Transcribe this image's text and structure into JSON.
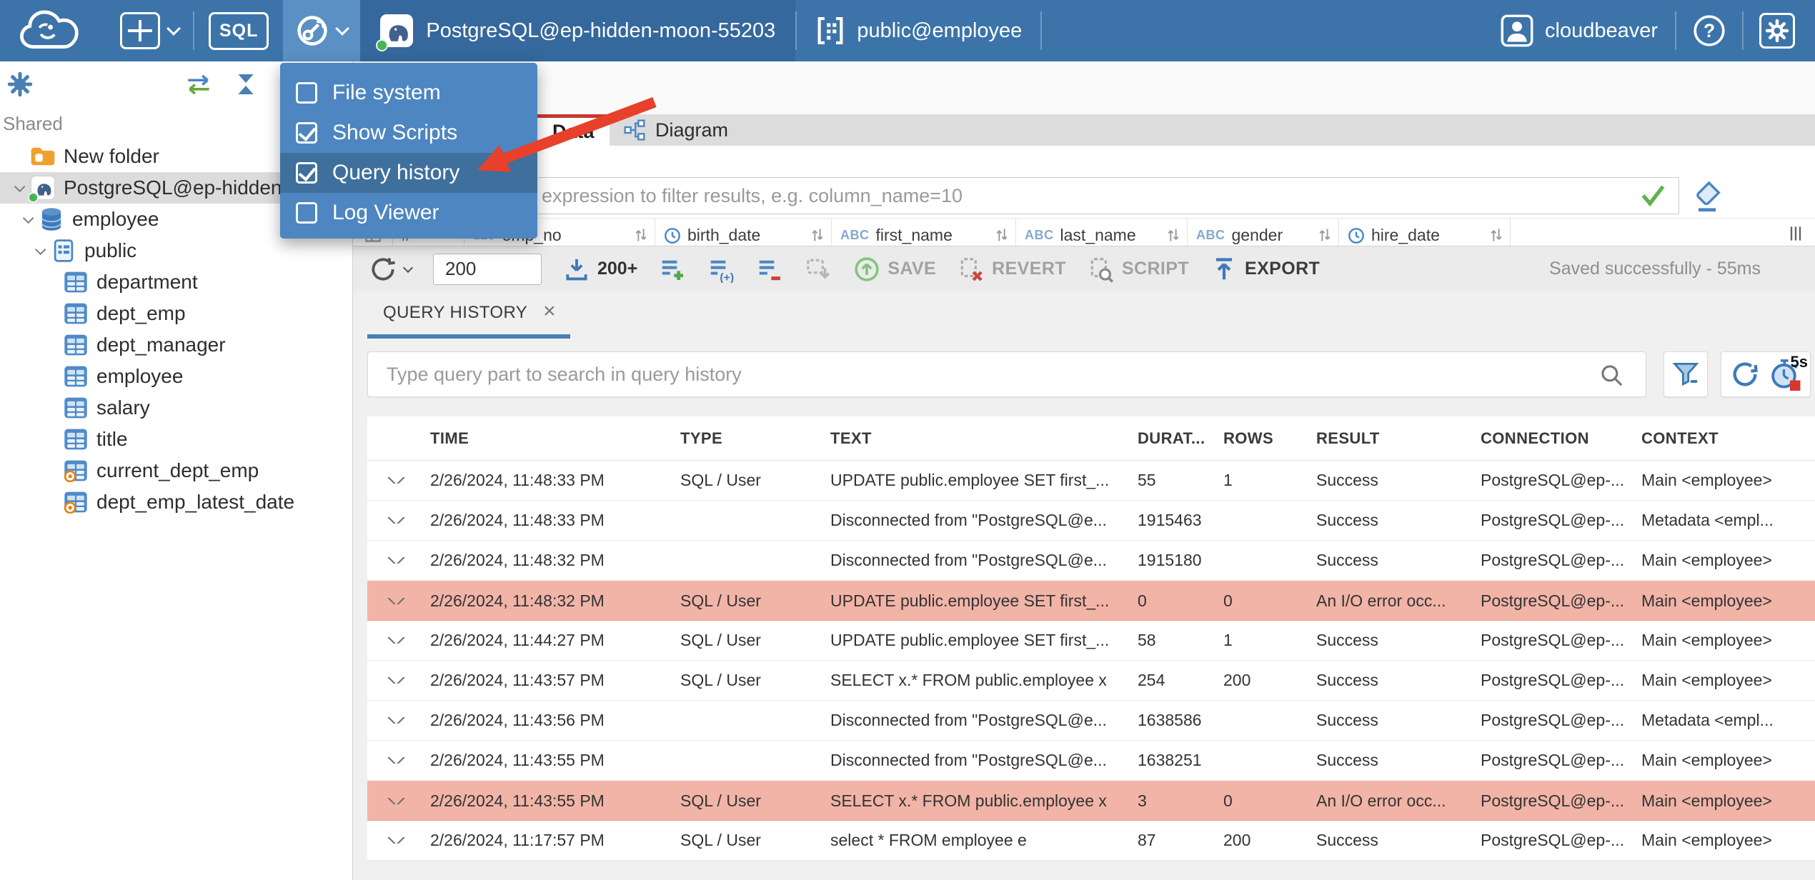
{
  "colors": {
    "topbar_blue": "#3c74a9",
    "accent_blue": "#4a7fb5",
    "menu_panel_blue": "#4d86c0",
    "menu_highlight_blue": "#3f6f9c",
    "active_tab_indicator_red": "#c8382e",
    "error_row_bg": "#f1b4a7",
    "arrow_annotation_red": "#e8402a",
    "success_check_green": "#5cb54e",
    "status_dot_green": "#49b356",
    "folder_orange": "#efa12c"
  },
  "topbar": {
    "sql_label": "SQL",
    "connection_label": "PostgreSQL@ep-hidden-moon-55203",
    "schema_label": "public@employee",
    "username": "cloudbeaver"
  },
  "tools_menu": {
    "items": [
      {
        "label": "File system",
        "checked": false,
        "highlighted": false
      },
      {
        "label": "Show Scripts",
        "checked": true,
        "highlighted": false
      },
      {
        "label": "Query history",
        "checked": true,
        "highlighted": true
      },
      {
        "label": "Log Viewer",
        "checked": false,
        "highlighted": false
      }
    ]
  },
  "sidebar": {
    "section_label": "Shared",
    "tree": [
      {
        "label": "New folder",
        "icon": "folder",
        "level": 0,
        "expanded": false,
        "selected": false
      },
      {
        "label": "PostgreSQL@ep-hidden-",
        "icon": "postgres",
        "level": 0,
        "expanded": true,
        "selected": true
      },
      {
        "label": "employee",
        "icon": "database",
        "level": 1,
        "expanded": true,
        "selected": false
      },
      {
        "label": "public",
        "icon": "schema",
        "level": 2,
        "expanded": true,
        "selected": false
      },
      {
        "label": "department",
        "icon": "table",
        "level": 3,
        "expanded": false,
        "selected": false
      },
      {
        "label": "dept_emp",
        "icon": "table",
        "level": 3,
        "expanded": false,
        "selected": false
      },
      {
        "label": "dept_manager",
        "icon": "table",
        "level": 3,
        "expanded": false,
        "selected": false
      },
      {
        "label": "employee",
        "icon": "table",
        "level": 3,
        "expanded": false,
        "selected": false
      },
      {
        "label": "salary",
        "icon": "table",
        "level": 3,
        "expanded": false,
        "selected": false
      },
      {
        "label": "title",
        "icon": "table",
        "level": 3,
        "expanded": false,
        "selected": false
      },
      {
        "label": "current_dept_emp",
        "icon": "view",
        "level": 3,
        "expanded": false,
        "selected": false
      },
      {
        "label": "dept_emp_latest_date",
        "icon": "view",
        "level": 3,
        "expanded": false,
        "selected": false
      }
    ]
  },
  "editor": {
    "tabs": [
      {
        "label": "Data",
        "active": true
      },
      {
        "label": "Diagram",
        "active": false
      }
    ],
    "filter": {
      "placeholder": "expression to filter results, e.g. column_name=10"
    },
    "grid_columns": [
      {
        "name": "#",
        "type": "index"
      },
      {
        "name": "emp_no",
        "type": "number"
      },
      {
        "name": "birth_date",
        "type": "date"
      },
      {
        "name": "first_name",
        "type": "string"
      },
      {
        "name": "last_name",
        "type": "string"
      },
      {
        "name": "gender",
        "type": "string"
      },
      {
        "name": "hire_date",
        "type": "date"
      }
    ],
    "toolbar": {
      "row_limit_value": "200",
      "fetch_more_label": "200+",
      "save_label": "SAVE",
      "revert_label": "REVERT",
      "script_label": "SCRIPT",
      "export_label": "EXPORT",
      "status_message": "Saved successfully - 55ms"
    }
  },
  "query_history": {
    "tab_label": "QUERY HISTORY",
    "search_placeholder": "Type query part to search in query history",
    "refresh_interval_label": "5s",
    "columns": [
      "TIME",
      "TYPE",
      "TEXT",
      "DURAT...",
      "ROWS",
      "RESULT",
      "CONNECTION",
      "CONTEXT"
    ],
    "rows": [
      {
        "time": "2/26/2024, 11:48:33 PM",
        "type": "SQL / User",
        "text": "UPDATE public.employee SET first_...",
        "duration": "55",
        "rows": "1",
        "result": "Success",
        "connection": "PostgreSQL@ep-...",
        "context": "Main <employee>",
        "error": false
      },
      {
        "time": "2/26/2024, 11:48:33 PM",
        "type": "",
        "text": "Disconnected from \"PostgreSQL@e...",
        "duration": "1915463",
        "rows": "",
        "result": "Success",
        "connection": "PostgreSQL@ep-...",
        "context": "Metadata <empl...",
        "error": false
      },
      {
        "time": "2/26/2024, 11:48:32 PM",
        "type": "",
        "text": "Disconnected from \"PostgreSQL@e...",
        "duration": "1915180",
        "rows": "",
        "result": "Success",
        "connection": "PostgreSQL@ep-...",
        "context": "Main <employee>",
        "error": false
      },
      {
        "time": "2/26/2024, 11:48:32 PM",
        "type": "SQL / User",
        "text": "UPDATE public.employee SET first_...",
        "duration": "0",
        "rows": "0",
        "result": "An I/O error occ...",
        "connection": "PostgreSQL@ep-...",
        "context": "Main <employee>",
        "error": true
      },
      {
        "time": "2/26/2024, 11:44:27 PM",
        "type": "SQL / User",
        "text": "UPDATE public.employee SET first_...",
        "duration": "58",
        "rows": "1",
        "result": "Success",
        "connection": "PostgreSQL@ep-...",
        "context": "Main <employee>",
        "error": false
      },
      {
        "time": "2/26/2024, 11:43:57 PM",
        "type": "SQL / User",
        "text": "SELECT x.* FROM public.employee x",
        "duration": "254",
        "rows": "200",
        "result": "Success",
        "connection": "PostgreSQL@ep-...",
        "context": "Main <employee>",
        "error": false
      },
      {
        "time": "2/26/2024, 11:43:56 PM",
        "type": "",
        "text": "Disconnected from \"PostgreSQL@e...",
        "duration": "1638586",
        "rows": "",
        "result": "Success",
        "connection": "PostgreSQL@ep-...",
        "context": "Metadata <empl...",
        "error": false
      },
      {
        "time": "2/26/2024, 11:43:55 PM",
        "type": "",
        "text": "Disconnected from \"PostgreSQL@e...",
        "duration": "1638251",
        "rows": "",
        "result": "Success",
        "connection": "PostgreSQL@ep-...",
        "context": "Main <employee>",
        "error": false
      },
      {
        "time": "2/26/2024, 11:43:55 PM",
        "type": "SQL / User",
        "text": "SELECT x.* FROM public.employee x",
        "duration": "3",
        "rows": "0",
        "result": "An I/O error occ...",
        "connection": "PostgreSQL@ep-...",
        "context": "Main <employee>",
        "error": true
      },
      {
        "time": "2/26/2024, 11:17:57 PM",
        "type": "SQL / User",
        "text": "select * FROM employee e",
        "duration": "87",
        "rows": "200",
        "result": "Success",
        "connection": "PostgreSQL@ep-...",
        "context": "Main <employee>",
        "error": false
      }
    ]
  }
}
